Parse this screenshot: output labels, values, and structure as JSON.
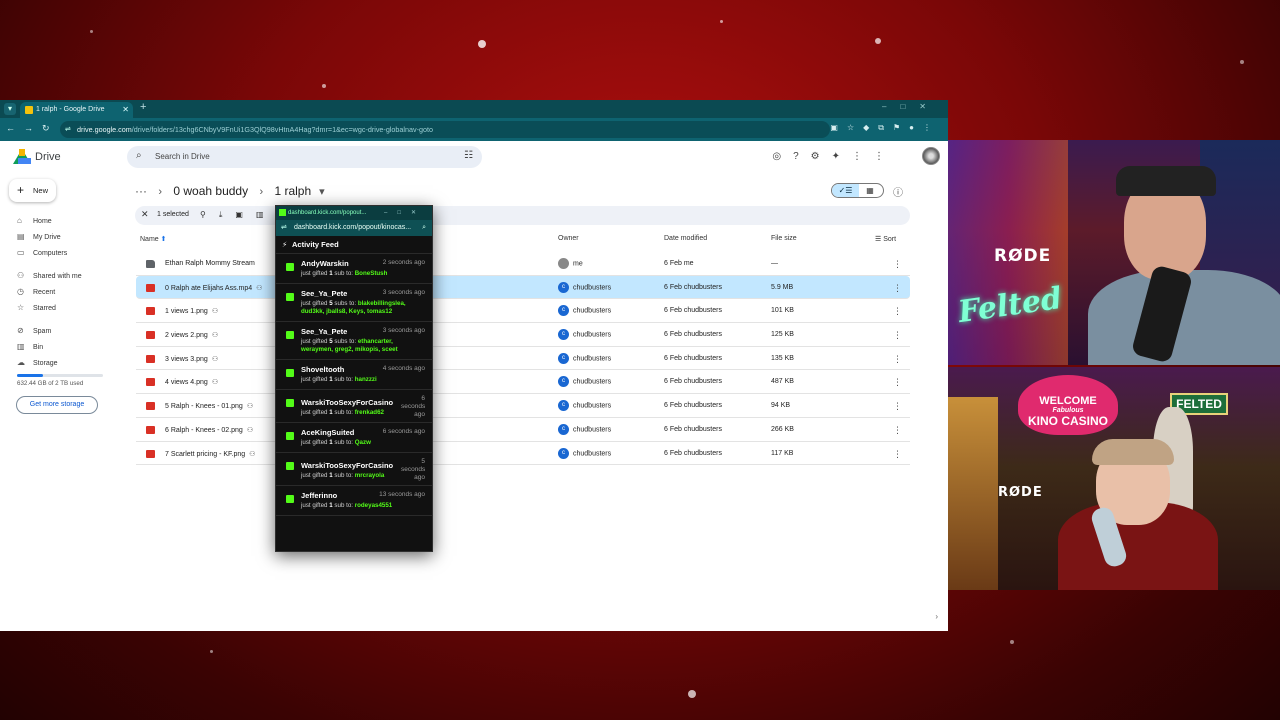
{
  "browser": {
    "tab_title": "1 ralph - Google Drive",
    "url_host": "drive.google.com",
    "url_path": "/drive/folders/13chg6CNbyV9FnUi1G3QlQ98vHtnA4Hag?dmr=1&ec=wgc-drive-globalnav-goto"
  },
  "drive": {
    "app_name": "Drive",
    "search_placeholder": "Search in Drive",
    "new_label": "New",
    "nav": [
      "Home",
      "My Drive",
      "Computers",
      "Shared with me",
      "Recent",
      "Starred",
      "Spam",
      "Bin",
      "Storage"
    ],
    "storage_text": "632.44 GB of 2 TB used",
    "get_storage_label": "Get more storage",
    "breadcrumb": [
      "0 woah buddy",
      "1 ralph"
    ],
    "selection_count": "1 selected",
    "columns": {
      "name": "Name",
      "owner": "Owner",
      "date": "Date modified",
      "size": "File size",
      "sort": "Sort"
    },
    "files": [
      {
        "name": "Ethan Ralph Mommy Stream",
        "type": "folder",
        "shared": false,
        "owner": "me",
        "avatar": "",
        "date": "6 Feb me",
        "size": "—",
        "selected": false
      },
      {
        "name": "0 Ralph ate Elijahs Ass.mp4",
        "type": "video",
        "shared": true,
        "owner": "chudbusters",
        "avatar": "c",
        "date": "6 Feb chudbusters",
        "size": "5.9 MB",
        "selected": true
      },
      {
        "name": "1 views 1.png",
        "type": "image",
        "shared": true,
        "owner": "chudbusters",
        "avatar": "c",
        "date": "6 Feb chudbusters",
        "size": "101 KB",
        "selected": false
      },
      {
        "name": "2 views 2.png",
        "type": "image",
        "shared": true,
        "owner": "chudbusters",
        "avatar": "c",
        "date": "6 Feb chudbusters",
        "size": "125 KB",
        "selected": false
      },
      {
        "name": "3 views 3.png",
        "type": "image",
        "shared": true,
        "owner": "chudbusters",
        "avatar": "c",
        "date": "6 Feb chudbusters",
        "size": "135 KB",
        "selected": false
      },
      {
        "name": "4 views 4.png",
        "type": "image",
        "shared": true,
        "owner": "chudbusters",
        "avatar": "c",
        "date": "6 Feb chudbusters",
        "size": "487 KB",
        "selected": false
      },
      {
        "name": "5 Ralph - Knees - 01.png",
        "type": "image",
        "shared": true,
        "owner": "chudbusters",
        "avatar": "c",
        "date": "6 Feb chudbusters",
        "size": "94 KB",
        "selected": false
      },
      {
        "name": "6 Ralph - Knees - 02.png",
        "type": "image",
        "shared": true,
        "owner": "chudbusters",
        "avatar": "c",
        "date": "6 Feb chudbusters",
        "size": "266 KB",
        "selected": false
      },
      {
        "name": "7 Scarlett pricing - KF.png",
        "type": "image",
        "shared": true,
        "owner": "chudbusters",
        "avatar": "c",
        "date": "6 Feb chudbusters",
        "size": "117 KB",
        "selected": false
      }
    ]
  },
  "popout": {
    "title": "dashboard.kick.com/popout...",
    "url": "dashboard.kick.com/popout/kinocas...",
    "header": "Activity Feed",
    "items": [
      {
        "user": "AndyWarskin",
        "time": "2 seconds ago",
        "text": "just gifted",
        "count": "1",
        "unit": "sub to:",
        "targets": "BoneStush"
      },
      {
        "user": "See_Ya_Pete",
        "time": "3 seconds ago",
        "text": "just gifted",
        "count": "5",
        "unit": "subs to:",
        "targets": "blakebillingslea, dud3kk, jballs8, Keys, tomas12"
      },
      {
        "user": "See_Ya_Pete",
        "time": "3 seconds ago",
        "text": "just gifted",
        "count": "5",
        "unit": "subs to:",
        "targets": "ethancarter, weraymen, greg2, mikopis, sceet"
      },
      {
        "user": "Shoveltooth",
        "time": "4 seconds ago",
        "text": "just gifted",
        "count": "1",
        "unit": "sub to:",
        "targets": "hanzzzi"
      },
      {
        "user": "WarskiTooSexyForCasino",
        "time": "6 seconds ago",
        "text": "just gifted",
        "count": "1",
        "unit": "sub to:",
        "targets": "frenkad62"
      },
      {
        "user": "AceKingSuited",
        "time": "6 seconds ago",
        "text": "just gifted",
        "count": "1",
        "unit": "sub to:",
        "targets": "Qazw"
      },
      {
        "user": "WarskiTooSexyForCasino",
        "time": "5 seconds ago",
        "text": "just gifted",
        "count": "1",
        "unit": "sub to:",
        "targets": "mrcrayola"
      },
      {
        "user": "Jefferinno",
        "time": "13 seconds ago",
        "text": "just gifted",
        "count": "1",
        "unit": "sub to:",
        "targets": "rodeyas4551"
      }
    ]
  },
  "cams": {
    "mic_brand": "RØDE",
    "neon_text": "Felted",
    "welcome_top": "WELCOME",
    "welcome_sub": "Fabulous",
    "welcome_main": "KINO CASINO",
    "felted_sign": "FELTED"
  },
  "colors": {
    "kick_green": "#53fc18",
    "drive_blue": "#1a73e8",
    "selected_row": "#c2e7ff",
    "chrome_teal": "#0e6370"
  }
}
